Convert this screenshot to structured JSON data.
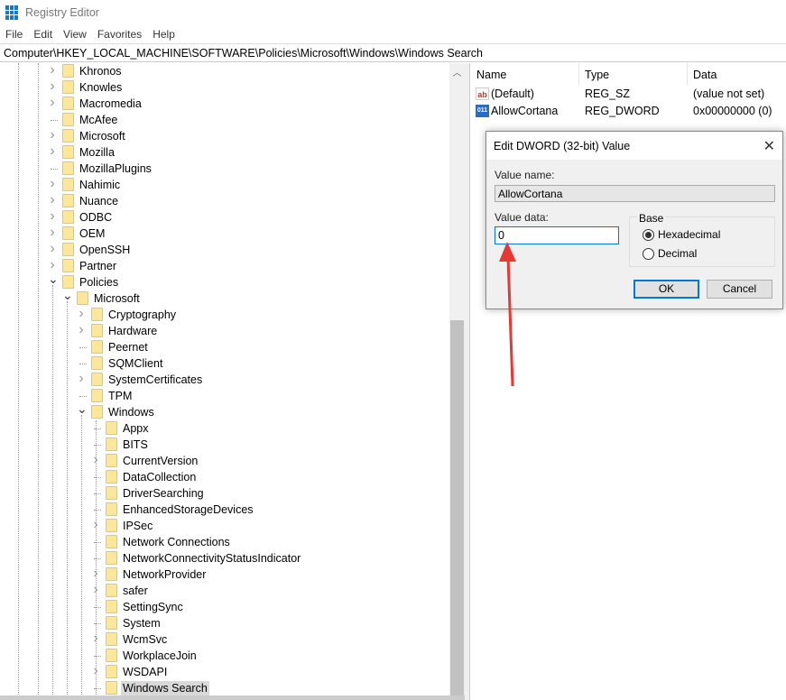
{
  "window": {
    "title": "Registry Editor"
  },
  "menu": [
    "File",
    "Edit",
    "View",
    "Favorites",
    "Help"
  ],
  "address": "Computer\\HKEY_LOCAL_MACHINE\\SOFTWARE\\Policies\\Microsoft\\Windows\\Windows Search",
  "tree": [
    {
      "label": "Khronos",
      "level": 1,
      "exp": "c"
    },
    {
      "label": "Knowles",
      "level": 1,
      "exp": "c"
    },
    {
      "label": "Macromedia",
      "level": 1,
      "exp": "c"
    },
    {
      "label": "McAfee",
      "level": 1,
      "exp": "n"
    },
    {
      "label": "Microsoft",
      "level": 1,
      "exp": "c"
    },
    {
      "label": "Mozilla",
      "level": 1,
      "exp": "c"
    },
    {
      "label": "MozillaPlugins",
      "level": 1,
      "exp": "n"
    },
    {
      "label": "Nahimic",
      "level": 1,
      "exp": "c"
    },
    {
      "label": "Nuance",
      "level": 1,
      "exp": "c"
    },
    {
      "label": "ODBC",
      "level": 1,
      "exp": "c"
    },
    {
      "label": "OEM",
      "level": 1,
      "exp": "c"
    },
    {
      "label": "OpenSSH",
      "level": 1,
      "exp": "c"
    },
    {
      "label": "Partner",
      "level": 1,
      "exp": "c"
    },
    {
      "label": "Policies",
      "level": 1,
      "exp": "e"
    },
    {
      "label": "Microsoft",
      "level": 2,
      "exp": "e"
    },
    {
      "label": "Cryptography",
      "level": 3,
      "exp": "c"
    },
    {
      "label": "Hardware",
      "level": 3,
      "exp": "c"
    },
    {
      "label": "Peernet",
      "level": 3,
      "exp": "n"
    },
    {
      "label": "SQMClient",
      "level": 3,
      "exp": "n"
    },
    {
      "label": "SystemCertificates",
      "level": 3,
      "exp": "c"
    },
    {
      "label": "TPM",
      "level": 3,
      "exp": "n"
    },
    {
      "label": "Windows",
      "level": 3,
      "exp": "e"
    },
    {
      "label": "Appx",
      "level": 4,
      "exp": "n"
    },
    {
      "label": "BITS",
      "level": 4,
      "exp": "n"
    },
    {
      "label": "CurrentVersion",
      "level": 4,
      "exp": "c"
    },
    {
      "label": "DataCollection",
      "level": 4,
      "exp": "n"
    },
    {
      "label": "DriverSearching",
      "level": 4,
      "exp": "n"
    },
    {
      "label": "EnhancedStorageDevices",
      "level": 4,
      "exp": "n"
    },
    {
      "label": "IPSec",
      "level": 4,
      "exp": "c"
    },
    {
      "label": "Network Connections",
      "level": 4,
      "exp": "n"
    },
    {
      "label": "NetworkConnectivityStatusIndicator",
      "level": 4,
      "exp": "n"
    },
    {
      "label": "NetworkProvider",
      "level": 4,
      "exp": "c"
    },
    {
      "label": "safer",
      "level": 4,
      "exp": "c"
    },
    {
      "label": "SettingSync",
      "level": 4,
      "exp": "n"
    },
    {
      "label": "System",
      "level": 4,
      "exp": "n"
    },
    {
      "label": "WcmSvc",
      "level": 4,
      "exp": "c"
    },
    {
      "label": "WorkplaceJoin",
      "level": 4,
      "exp": "n"
    },
    {
      "label": "WSDAPI",
      "level": 4,
      "exp": "c"
    },
    {
      "label": "Windows Search",
      "level": 4,
      "exp": "n",
      "selected": true
    }
  ],
  "values": {
    "headers": {
      "name": "Name",
      "type": "Type",
      "data": "Data"
    },
    "rows": [
      {
        "icon": "ab",
        "name": "(Default)",
        "type": "REG_SZ",
        "data": "(value not set)"
      },
      {
        "icon": "011",
        "name": "AllowCortana",
        "type": "REG_DWORD",
        "data": "0x00000000 (0)"
      }
    ]
  },
  "dialog": {
    "title": "Edit DWORD (32-bit) Value",
    "value_name_label": "Value name:",
    "value_name": "AllowCortana",
    "value_data_label": "Value data:",
    "value_data": "0",
    "base_label": "Base",
    "hex_label": "Hexadecimal",
    "dec_label": "Decimal",
    "ok": "OK",
    "cancel": "Cancel"
  },
  "colors": {
    "accent": "#0078d7",
    "arrow": "#e53935",
    "folder": "#fde79a"
  }
}
